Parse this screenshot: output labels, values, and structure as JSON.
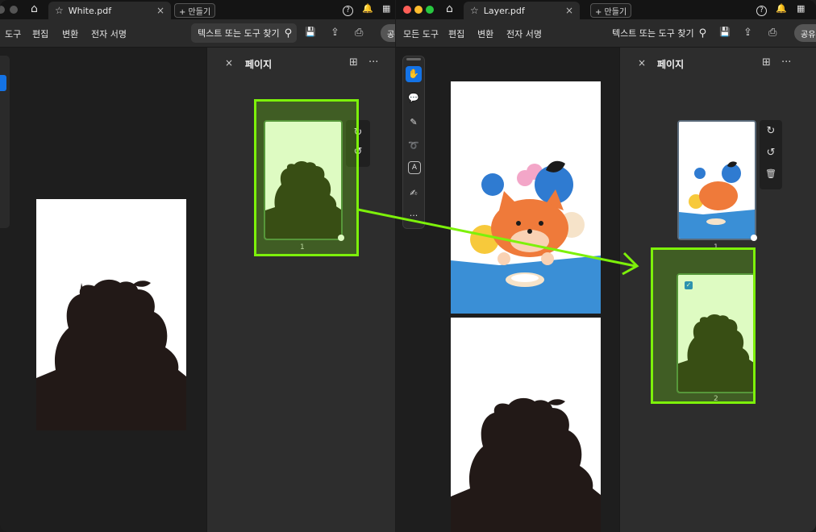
{
  "left_window": {
    "tab_title": "White.pdf",
    "new_button": "+ 만들기",
    "menu": [
      "도구",
      "편집",
      "변환",
      "전자 서명"
    ],
    "search_label": "텍스트 또는 도구 찾기",
    "share_label": "공유",
    "panel": {
      "title": "페이지",
      "close": "×",
      "more": "···"
    },
    "thumb_page_number": "1"
  },
  "right_window": {
    "tab_title": "Layer.pdf",
    "new_button": "+ 만들기",
    "menu": [
      "모든 도구",
      "편집",
      "변환",
      "전자 서명"
    ],
    "search_label": "텍스트 또는 도구 찾기",
    "share_label": "공유",
    "panel": {
      "title": "페이지",
      "close": "×",
      "more": "···"
    },
    "thumb_page_numbers": [
      "1",
      "2"
    ]
  },
  "icons": {
    "home": "⌂",
    "star": "☆",
    "close": "×",
    "help": "?",
    "bell": "🔔",
    "search": "⚲",
    "save": "💾",
    "upload": "⇪",
    "print": "⎙",
    "rotate_cw": "↻",
    "rotate_ccw": "↺",
    "trash": "🗑",
    "add_page": "⊞",
    "hand": "✋",
    "comment": "💬",
    "pen": "✎",
    "lasso": "➰",
    "text_select": "A",
    "sign": "✍",
    "more": "···"
  },
  "colors": {
    "highlight": "#7df10a",
    "silhouette": "#221917",
    "blue": "#3a8fd6",
    "fox": "#ef7a3a"
  }
}
